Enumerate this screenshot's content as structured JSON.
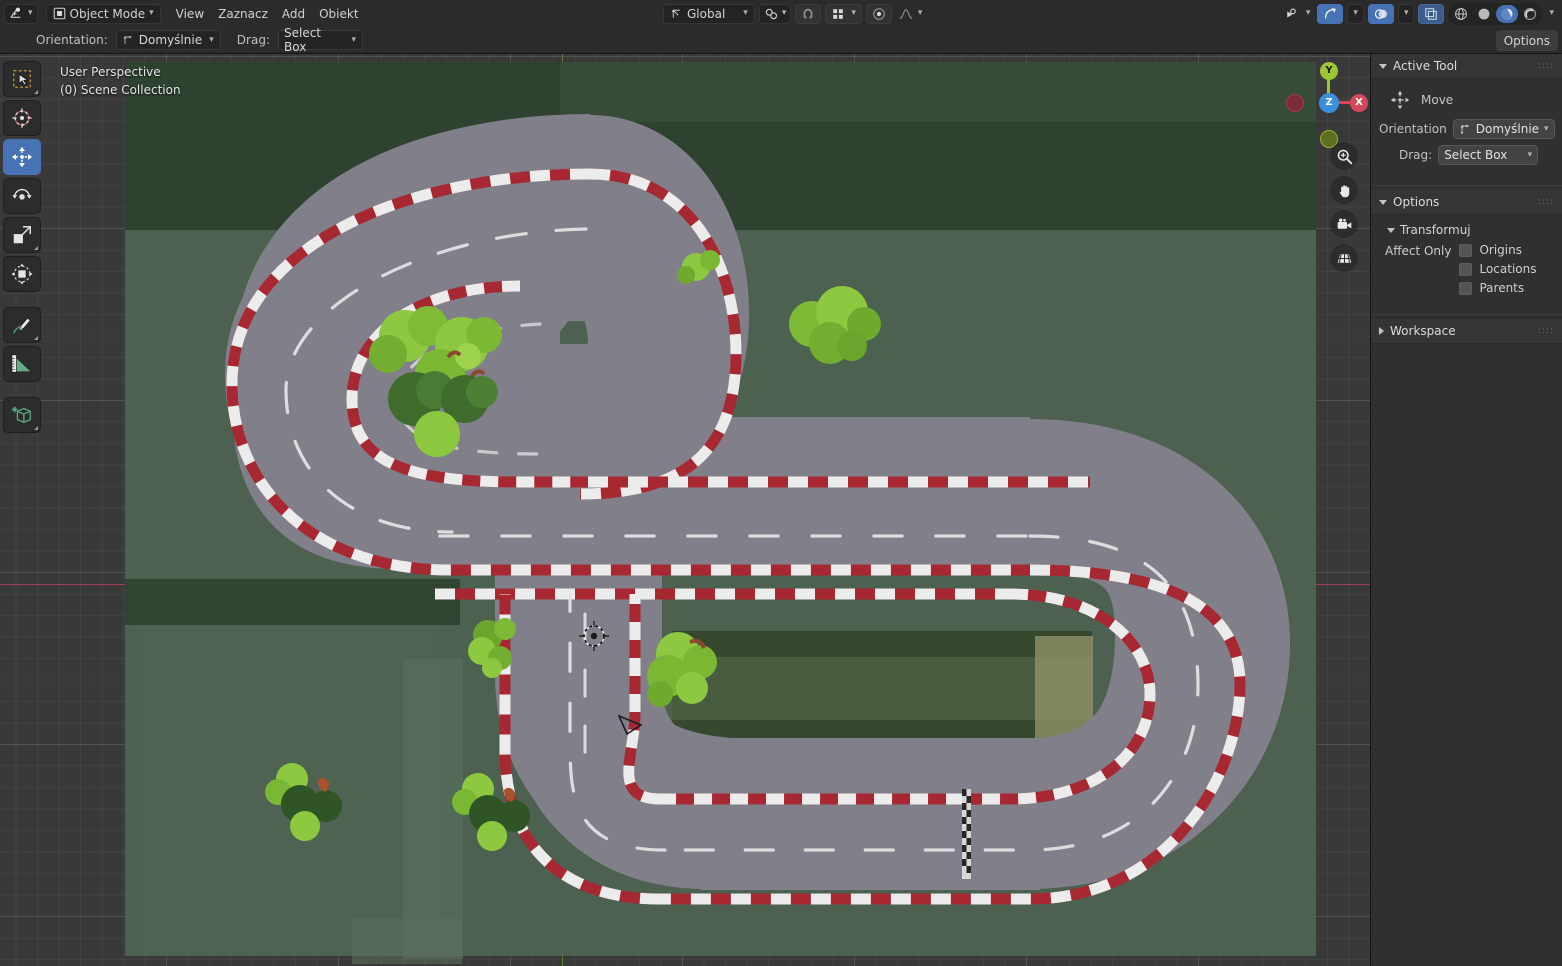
{
  "topbar": {
    "editor_type_icon": "editor-type-icon",
    "mode_selector": {
      "label": "Object Mode",
      "icon": "object-mode-icon"
    },
    "menus": [
      "View",
      "Zaznacz",
      "Add",
      "Obiekt"
    ],
    "transform_orientation": {
      "label": "Global",
      "icon": "orientation-axes-icon"
    },
    "snap_icon": "magnet-icon",
    "proportional_icon": "proportional-edit-icon",
    "proportional_grid_icon": "proportional-grid-icon",
    "falloff_icon": "falloff-curve-icon",
    "pivot_icon": "pivot-point-icon",
    "visibility_icon": "visibility-eye-icon",
    "gizmo_icon": "gizmo-icon",
    "overlays_icon": "overlays-icon",
    "xray_icon": "xray-toggle-icon",
    "shading_wireframe_icon": "shading-wireframe-icon",
    "shading_solid_icon": "shading-solid-icon",
    "shading_material_icon": "shading-material-preview-icon",
    "shading_rendered_icon": "shading-rendered-icon"
  },
  "toolsettings": {
    "orientation_label": "Orientation:",
    "orientation_value": "Domyślnie",
    "drag_label": "Drag:",
    "drag_value": "Select Box",
    "options_button": "Options"
  },
  "viewport": {
    "perspective_label": "User Perspective",
    "collection_label": "(0) Scene Collection",
    "colors": {
      "grid_background": "#393939",
      "ground_green": "#4c6150",
      "ground_dark_green": "#2f4430",
      "asphalt": "#81808a",
      "kerb_red": "#a82832",
      "kerb_white": "#e9e9e9",
      "axis_x_red": "#a33b52",
      "axis_y_green": "#5c7a33",
      "tree_leaf_light": "#8cc63e",
      "tree_leaf_dark": "#3e6b33",
      "trunk_brown": "#8b4a2b"
    },
    "gizmo": {
      "axes": [
        {
          "name": "Y",
          "color": "#9bc832",
          "label": "Y"
        },
        {
          "name": "Z",
          "color": "#3b8fdb",
          "label": "Z"
        },
        {
          "name": "X",
          "color": "#d6475a",
          "label": "X"
        }
      ],
      "negative_axes": [
        {
          "name": "-X",
          "color": "#7a2c38"
        },
        {
          "name": "-Y",
          "color": "#647f22"
        }
      ]
    },
    "nav_buttons": [
      "zoom-icon",
      "hand-pan-icon",
      "camera-view-icon",
      "orthographic-grid-icon"
    ],
    "cursor_3d": "3d-cursor",
    "empty_object": "camera-empty-object"
  },
  "left_toolbar": [
    {
      "name": "tweak-select-box-tool",
      "icon": "select-box-icon",
      "active": false
    },
    {
      "name": "cursor-tool",
      "icon": "3d-cursor-icon",
      "active": false
    },
    {
      "name": "move-tool",
      "icon": "move-arrows-icon",
      "active": true
    },
    {
      "name": "rotate-tool",
      "icon": "rotate-icon",
      "active": false
    },
    {
      "name": "scale-tool",
      "icon": "scale-icon",
      "active": false
    },
    {
      "name": "transform-tool",
      "icon": "transform-icon",
      "active": false
    },
    {
      "name": "annotate-tool",
      "icon": "pencil-annotate-icon",
      "active": false
    },
    {
      "name": "measure-tool",
      "icon": "ruler-measure-icon",
      "active": false
    },
    {
      "name": "add-cube-tool",
      "icon": "add-cube-icon",
      "active": false
    }
  ],
  "sidebar": {
    "active_tool_panel": {
      "title": "Active Tool",
      "tool_name": "Move",
      "tool_icon": "move-arrows-icon",
      "orientation_label": "Orientation",
      "orientation_value": "Domyślnie",
      "drag_label": "Drag:",
      "drag_value": "Select Box"
    },
    "options_panel": {
      "title": "Options",
      "transform_subpanel": "Transformuj",
      "affect_only_label": "Affect Only",
      "checkboxes": [
        {
          "label": "Origins",
          "checked": false
        },
        {
          "label": "Locations",
          "checked": false
        },
        {
          "label": "Parents",
          "checked": false
        }
      ]
    },
    "workspace_panel": {
      "title": "Workspace"
    }
  }
}
